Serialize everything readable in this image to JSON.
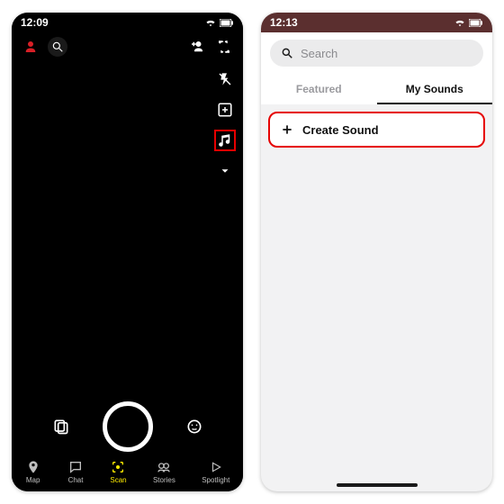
{
  "left": {
    "status": {
      "time": "12:09"
    },
    "nav": {
      "map": "Map",
      "chat": "Chat",
      "scan": "Scan",
      "stories": "Stories",
      "spotlight": "Spotlight"
    }
  },
  "right": {
    "status": {
      "time": "12:13"
    },
    "search": {
      "placeholder": "Search"
    },
    "tabs": {
      "featured": "Featured",
      "mysounds": "My Sounds"
    },
    "create_label": "Create Sound"
  }
}
